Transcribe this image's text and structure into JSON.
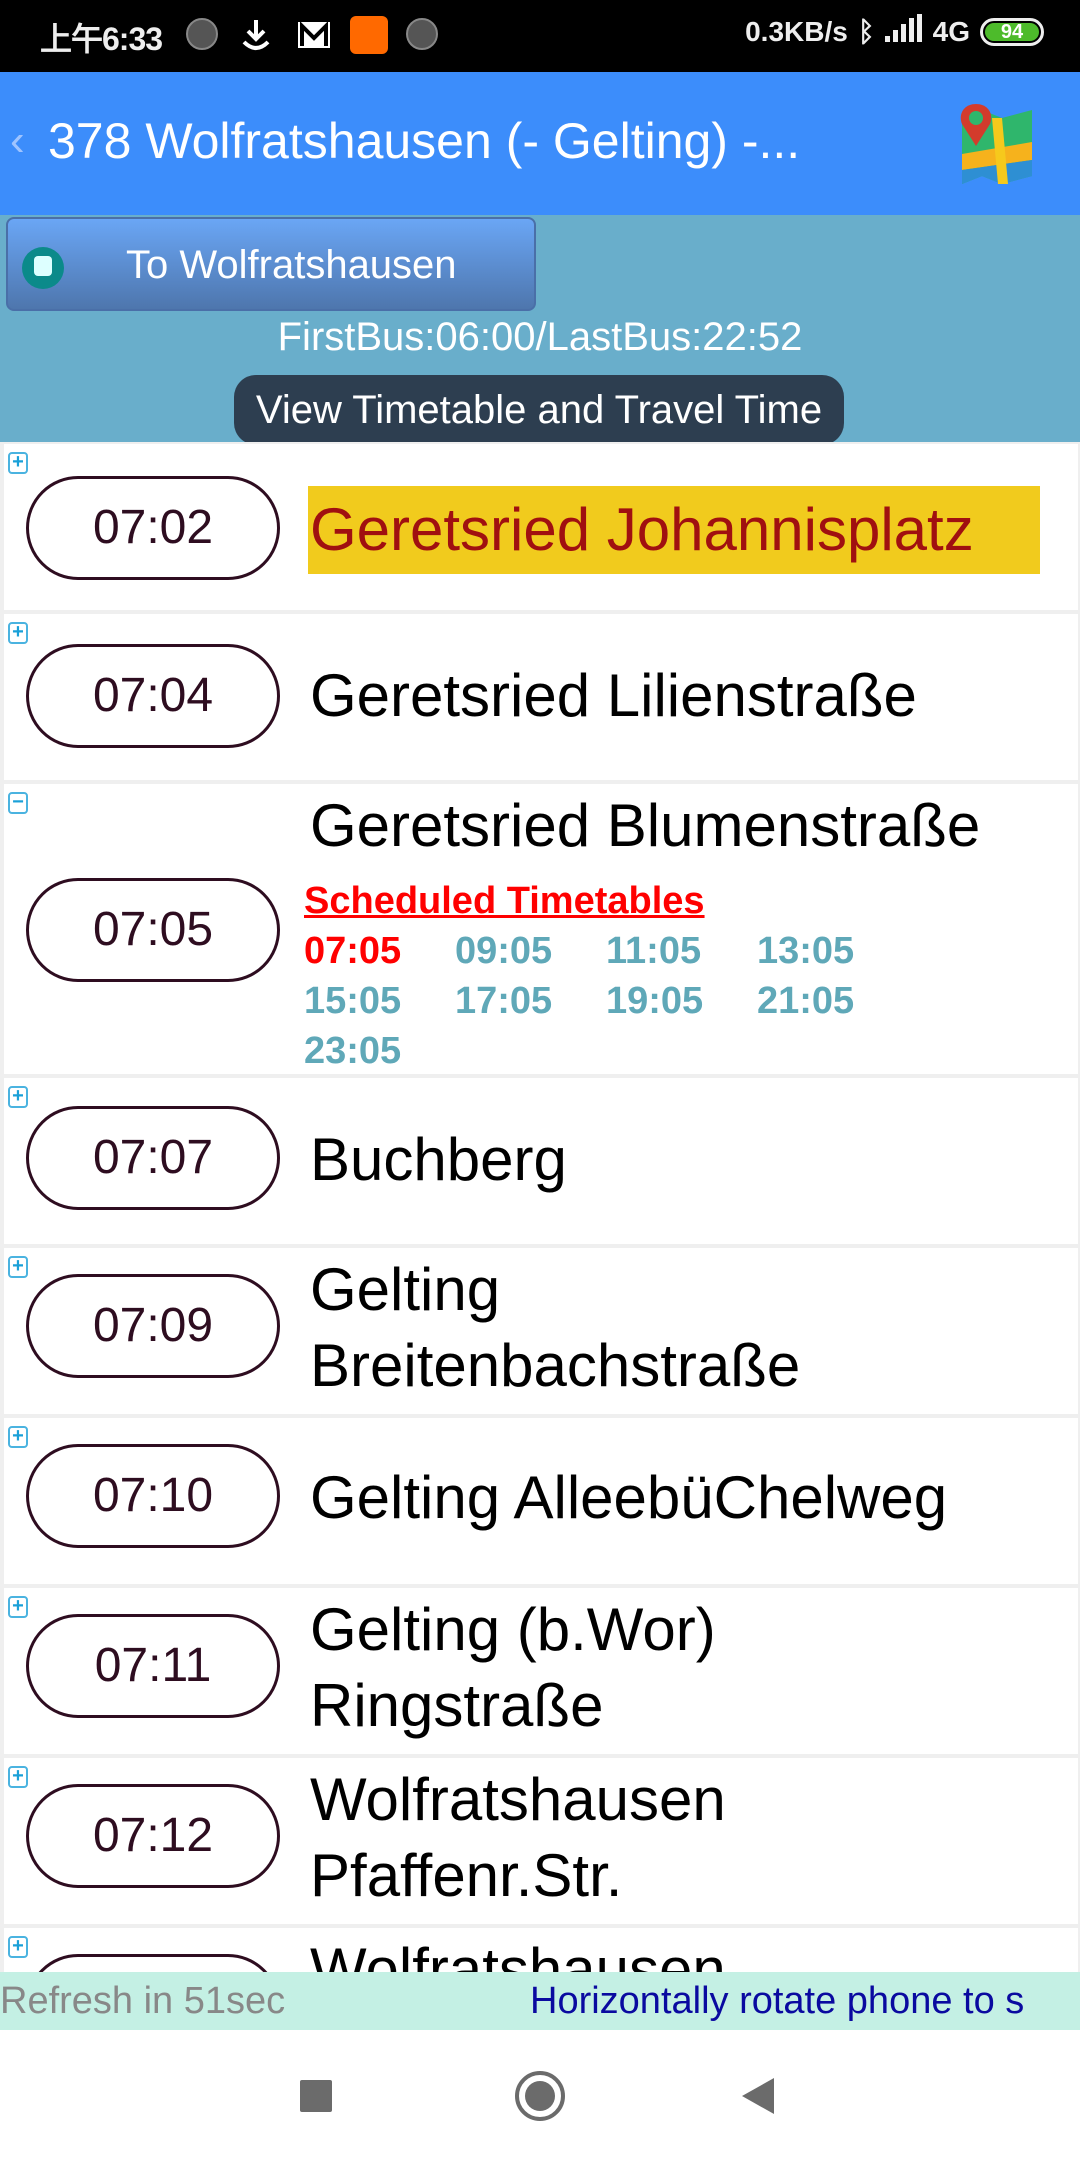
{
  "status_bar": {
    "time": "上午6:33",
    "network_speed": "0.3KB/s",
    "network_type": "4G",
    "battery": "94",
    "icons": [
      "loading-icon",
      "download-icon",
      "gmail-icon",
      "mi-icon",
      "loading-icon",
      "bluetooth-icon",
      "signal-icon"
    ]
  },
  "header": {
    "back_icon": "‹",
    "title": "378 Wolfratshausen (- Gelting) -...",
    "map_icon": "map-icon"
  },
  "controls": {
    "direction_button": "To Wolfratshausen",
    "first_last": "FirstBus:06:00/LastBus:22:52",
    "view_timetable": "View Timetable and Travel Time"
  },
  "stops": [
    {
      "time": "07:02",
      "name": "Geretsried Johannisplatz",
      "toggle": "+",
      "current": true
    },
    {
      "time": "07:04",
      "name": "Geretsried Lilienstraße",
      "toggle": "+"
    },
    {
      "time": "07:05",
      "name": "Geretsried Blumenstraße",
      "toggle": "−",
      "expanded": true,
      "schedule_title": "Scheduled Timetables",
      "schedule": [
        "07:05",
        "09:05",
        "11:05",
        "13:05",
        "15:05",
        "17:05",
        "19:05",
        "21:05",
        "23:05"
      ],
      "schedule_active": "07:05"
    },
    {
      "time": "07:07",
      "name": "Buchberg",
      "toggle": "+"
    },
    {
      "time": "07:09",
      "name": "Gelting\nBreitenbachstraße",
      "line1": "Gelting",
      "line2": "Breitenbachstraße",
      "toggle": "+"
    },
    {
      "time": "07:10",
      "name": "Gelting AlleebüChelweg",
      "toggle": "+"
    },
    {
      "time": "07:11",
      "name": "Gelting (b.Wor) Ringstraße",
      "line1": "Gelting (b.Wor)",
      "line2": "Ringstraße",
      "toggle": "+"
    },
    {
      "time": "07:12",
      "name": "Wolfratshausen Pfaffenr.Str.",
      "line1": "Wolfratshausen",
      "line2": "Pfaffenr.Str.",
      "toggle": "+"
    },
    {
      "time": "",
      "name": "Wolfratshausen",
      "toggle": "+"
    }
  ],
  "footer": {
    "refresh": "Refresh in 51sec",
    "marquee": "Horizontally rotate phone to s"
  },
  "colors": {
    "header": "#3c8dfb",
    "controls_bg": "#69aecb",
    "current_stop_bg": "#f1cb1d",
    "current_stop_text": "#a01010",
    "schedule_active": "#ff0000",
    "schedule_other": "#5fa8b8",
    "footer_bg": "#c4f0e4"
  }
}
